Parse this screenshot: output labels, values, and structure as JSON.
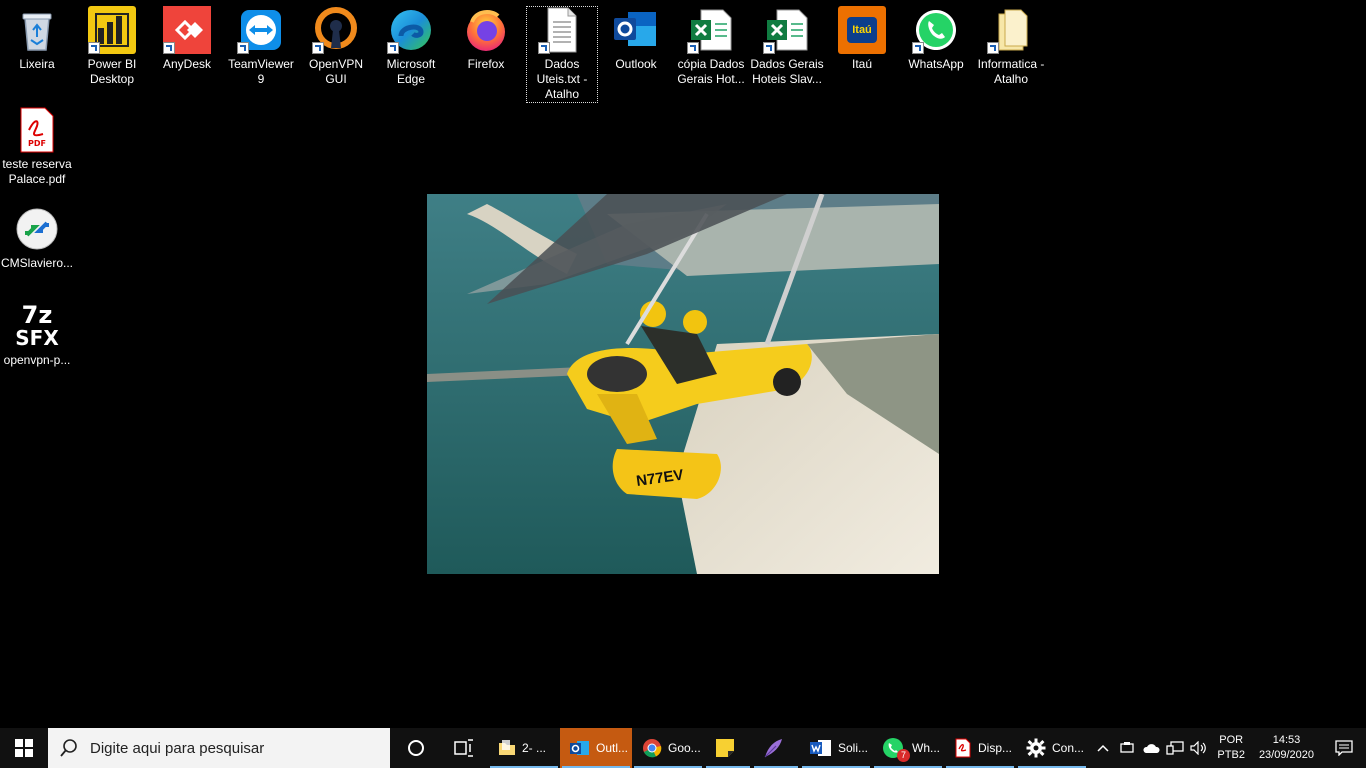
{
  "desktop": {
    "icons": [
      {
        "label": "Lixeira",
        "icon": "recycle-bin-icon"
      },
      {
        "label": "Power BI\nDesktop",
        "icon": "powerbi-icon"
      },
      {
        "label": "AnyDesk",
        "icon": "anydesk-icon"
      },
      {
        "label": "TeamViewer\n9",
        "icon": "teamviewer-icon"
      },
      {
        "label": "OpenVPN\nGUI",
        "icon": "openvpn-icon"
      },
      {
        "label": "Microsoft\nEdge",
        "icon": "edge-icon"
      },
      {
        "label": "Firefox",
        "icon": "firefox-icon"
      },
      {
        "label": "Dados\nUteis.txt -\nAtalho",
        "icon": "text-file-icon"
      },
      {
        "label": "Outlook",
        "icon": "outlook-icon"
      },
      {
        "label": "cópia Dados\nGerais Hot...",
        "icon": "excel-icon"
      },
      {
        "label": "Dados Gerais\nHoteis Slav...",
        "icon": "excel-icon"
      },
      {
        "label": "Itaú",
        "icon": "itau-icon"
      },
      {
        "label": "WhatsApp",
        "icon": "whatsapp-icon"
      },
      {
        "label": "Informatica -\nAtalho",
        "icon": "folder-icon"
      },
      {
        "label": "teste reserva\nPalace.pdf",
        "icon": "pdf-icon"
      },
      {
        "label": "CMSlaviero...",
        "icon": "remote-desktop-icon"
      },
      {
        "label": "openvpn-p...",
        "icon": "7z-sfx-icon"
      }
    ],
    "brand_text": {
      "powerbi": "",
      "itau": "Itaú",
      "pdf": "PDF",
      "sfx_top": "7z",
      "sfx_bottom": "SFX",
      "plane_reg": "N77EV"
    }
  },
  "taskbar": {
    "search_placeholder": "Digite aqui para pesquisar",
    "tasks": [
      {
        "label": "2- ...",
        "icon": "file-explorer-icon",
        "active": false
      },
      {
        "label": "Outl...",
        "icon": "outlook-icon",
        "active": true
      },
      {
        "label": "Goo...",
        "icon": "chrome-icon",
        "active": false
      },
      {
        "label": "",
        "icon": "sticky-notes-icon",
        "active": false
      },
      {
        "label": "",
        "icon": "feather-icon",
        "active": false
      },
      {
        "label": "Soli...",
        "icon": "word-icon",
        "active": false
      },
      {
        "label": "Wh...",
        "icon": "whatsapp-icon",
        "active": false,
        "badge": "7"
      },
      {
        "label": "Disp...",
        "icon": "pdf-icon",
        "active": false
      },
      {
        "label": "Con...",
        "icon": "settings-icon",
        "active": false
      }
    ],
    "tray": {
      "lang_top": "POR",
      "lang_bottom": "PTB2",
      "time": "14:53",
      "date": "23/09/2020"
    }
  },
  "colors": {
    "accent": "#0078d7",
    "active_task": "#c55a11",
    "taskbar_bg": "#111111",
    "search_bg": "#f3f3f3"
  }
}
